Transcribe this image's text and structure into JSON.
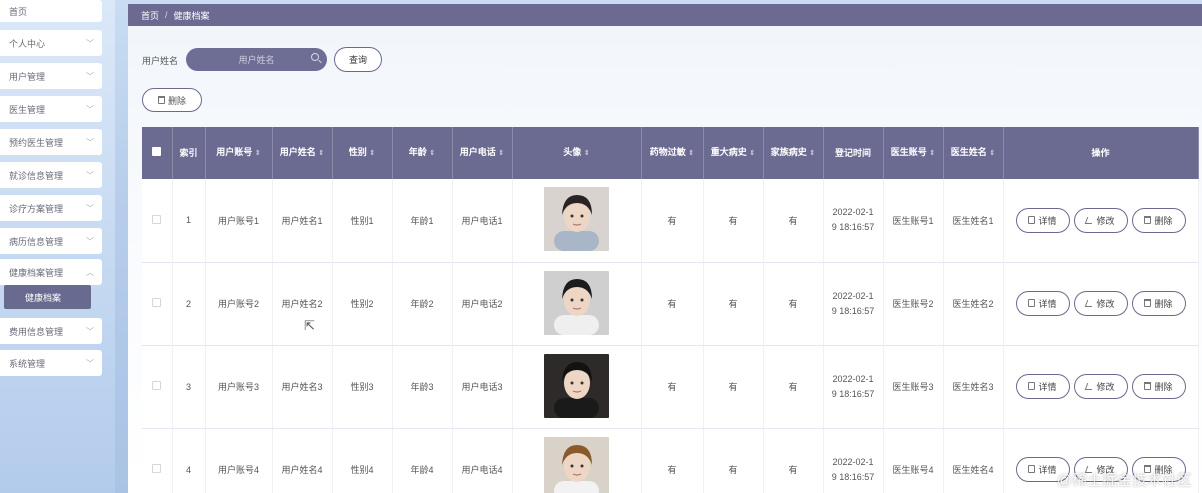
{
  "sidebar": {
    "items": [
      {
        "label": "首页",
        "chevron": false
      },
      {
        "label": "个人中心",
        "chevron": true
      },
      {
        "label": "用户管理",
        "chevron": true
      },
      {
        "label": "医生管理",
        "chevron": true
      },
      {
        "label": "预约医生管理",
        "chevron": true
      },
      {
        "label": "就诊信息管理",
        "chevron": true
      },
      {
        "label": "诊疗方案管理",
        "chevron": true
      },
      {
        "label": "病历信息管理",
        "chevron": true
      },
      {
        "label": "健康档案管理",
        "chevron": true
      },
      {
        "label": "费用信息管理",
        "chevron": true
      },
      {
        "label": "系统管理",
        "chevron": true
      }
    ],
    "active_sub": "健康档案"
  },
  "breadcrumb": {
    "home": "首页",
    "separator": "/",
    "current": "健康档案"
  },
  "search": {
    "label": "用户姓名",
    "placeholder": "用户姓名",
    "query_button": "查询"
  },
  "toolbar": {
    "delete_button": "删除"
  },
  "table": {
    "headers": [
      "",
      "索引",
      "用户账号",
      "用户姓名",
      "性别",
      "年龄",
      "用户电话",
      "头像",
      "药物过敏",
      "重大病史",
      "家族病史",
      "登记时间",
      "医生账号",
      "医生姓名",
      "操作"
    ],
    "sortable": [
      false,
      false,
      true,
      true,
      true,
      true,
      true,
      true,
      true,
      true,
      true,
      false,
      true,
      true,
      false
    ],
    "sort_icon": "⇕",
    "actions": {
      "detail": "详情",
      "edit": "修改",
      "delete": "删除"
    },
    "rows": [
      {
        "index": "1",
        "account": "用户账号1",
        "name": "用户姓名1",
        "gender": "性别1",
        "age": "年龄1",
        "phone": "用户电话1",
        "avatar": "avatar-girl",
        "allergy": "有",
        "major": "有",
        "family": "有",
        "time_line1": "2022-02-1",
        "time_line2": "9 18:16:57",
        "doctor_account": "医生账号1",
        "doctor_name": "医生姓名1"
      },
      {
        "index": "2",
        "account": "用户账号2",
        "name": "用户姓名2",
        "gender": "性别2",
        "age": "年龄2",
        "phone": "用户电话2",
        "avatar": "avatar-boy-white",
        "allergy": "有",
        "major": "有",
        "family": "有",
        "time_line1": "2022-02-1",
        "time_line2": "9 18:16:57",
        "doctor_account": "医生账号2",
        "doctor_name": "医生姓名2"
      },
      {
        "index": "3",
        "account": "用户账号3",
        "name": "用户姓名3",
        "gender": "性别3",
        "age": "年龄3",
        "phone": "用户电话3",
        "avatar": "avatar-boy-dark",
        "allergy": "有",
        "major": "有",
        "family": "有",
        "time_line1": "2022-02-1",
        "time_line2": "9 18:16:57",
        "doctor_account": "医生账号3",
        "doctor_name": "医生姓名3"
      },
      {
        "index": "4",
        "account": "用户账号4",
        "name": "用户姓名4",
        "gender": "性别4",
        "age": "年龄4",
        "phone": "用户电话4",
        "avatar": "avatar-boy-blond",
        "allergy": "有",
        "major": "有",
        "family": "有",
        "time_line1": "2022-02-1",
        "time_line2": "9 18:16:57",
        "doctor_account": "医生账号4",
        "doctor_name": "医生姓名4"
      }
    ]
  },
  "watermark": "@稀土掘金技术社区",
  "colors": {
    "primary": "#6b6a90",
    "sidebar_active": "#696a8f"
  }
}
